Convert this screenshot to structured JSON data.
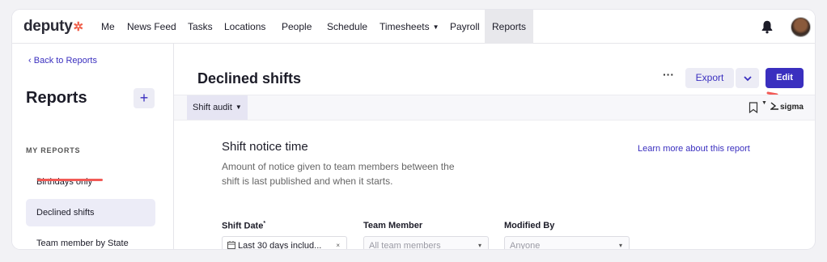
{
  "brand": {
    "name": "deputy",
    "accent": "#3a2fbf",
    "logo_color": "#f0624d"
  },
  "nav": {
    "items": [
      {
        "label": "Me"
      },
      {
        "label": "News Feed"
      },
      {
        "label": "Tasks"
      },
      {
        "label": "Locations"
      },
      {
        "label": "People"
      },
      {
        "label": "Schedule"
      },
      {
        "label": "Timesheets"
      },
      {
        "label": "Payroll"
      },
      {
        "label": "Reports"
      }
    ],
    "active": "Reports"
  },
  "sidebar": {
    "back_label": "Back to Reports",
    "title": "Reports",
    "add_label": "+",
    "section_label": "MY REPORTS",
    "items": [
      {
        "label": "Birthdays only"
      },
      {
        "label": "Declined shifts"
      },
      {
        "label": "Team member by State"
      }
    ]
  },
  "main": {
    "title": "Declined shifts",
    "more_label": "···",
    "export_label": "Export",
    "edit_label": "Edit",
    "tab_label": "Shift audit",
    "sigma_label": "sigma",
    "report": {
      "title": "Shift notice time",
      "learn_more": "Learn more about this report",
      "description": "Amount of notice given to team members between the shift is last published and when it starts."
    },
    "filters": [
      {
        "label": "Shift Date",
        "required_mark": "*",
        "value": "Last 30 days includ...",
        "end": "×"
      },
      {
        "label": "Team Member",
        "value": "All team members",
        "end": "▾"
      },
      {
        "label": "Modified By",
        "value": "Anyone",
        "end": "▾"
      }
    ]
  },
  "annotation_color": "#f25a56"
}
